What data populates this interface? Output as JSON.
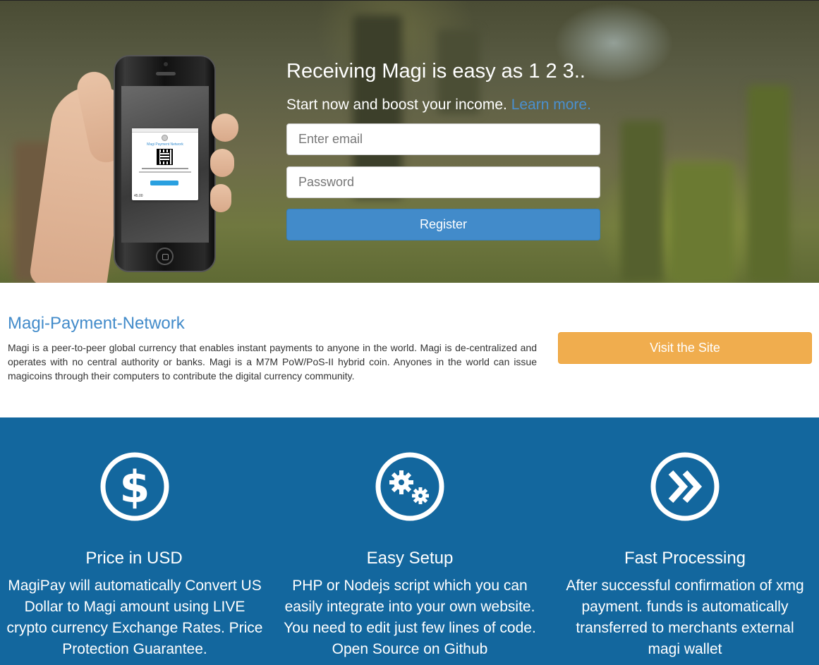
{
  "hero": {
    "title": "Receiving Magi is easy as 1 2 3..",
    "subtitle": "Start now and boost your income.",
    "learn_more": "Learn more.",
    "email_placeholder": "Enter email",
    "password_placeholder": "Password",
    "register_label": "Register",
    "phone_screen": {
      "card_title": "Magi Payment Network",
      "amount": "45.00"
    }
  },
  "info": {
    "title": "Magi-Payment-Network",
    "text": "Magi is a peer-to-peer global currency that enables instant payments to anyone in the world. Magi is de-centralized and operates with no central authority or banks. Magi is a M7M PoW/PoS-II hybrid coin. Anyones in the world can issue magicoins through their computers to contribute the digital currency community.",
    "visit_label": "Visit the Site"
  },
  "features": [
    {
      "icon": "dollar-icon",
      "title": "Price in USD",
      "description": "MagiPay will automatically Convert US Dollar to Magi amount using LIVE crypto currency Exchange Rates. Price Protection Guarantee."
    },
    {
      "icon": "gears-icon",
      "title": "Easy Setup",
      "description": "PHP or Nodejs script which you can easily integrate into your own website. You need to edit just few lines of code. Open Source on Github"
    },
    {
      "icon": "fast-forward-icon",
      "title": "Fast Processing",
      "description": "After successful confirmation of xmg payment. funds is automatically transferred to merchants external magi wallet"
    }
  ],
  "colors": {
    "primary": "#428bca",
    "warning": "#f0ad4e",
    "feature_bg": "#13679e"
  }
}
